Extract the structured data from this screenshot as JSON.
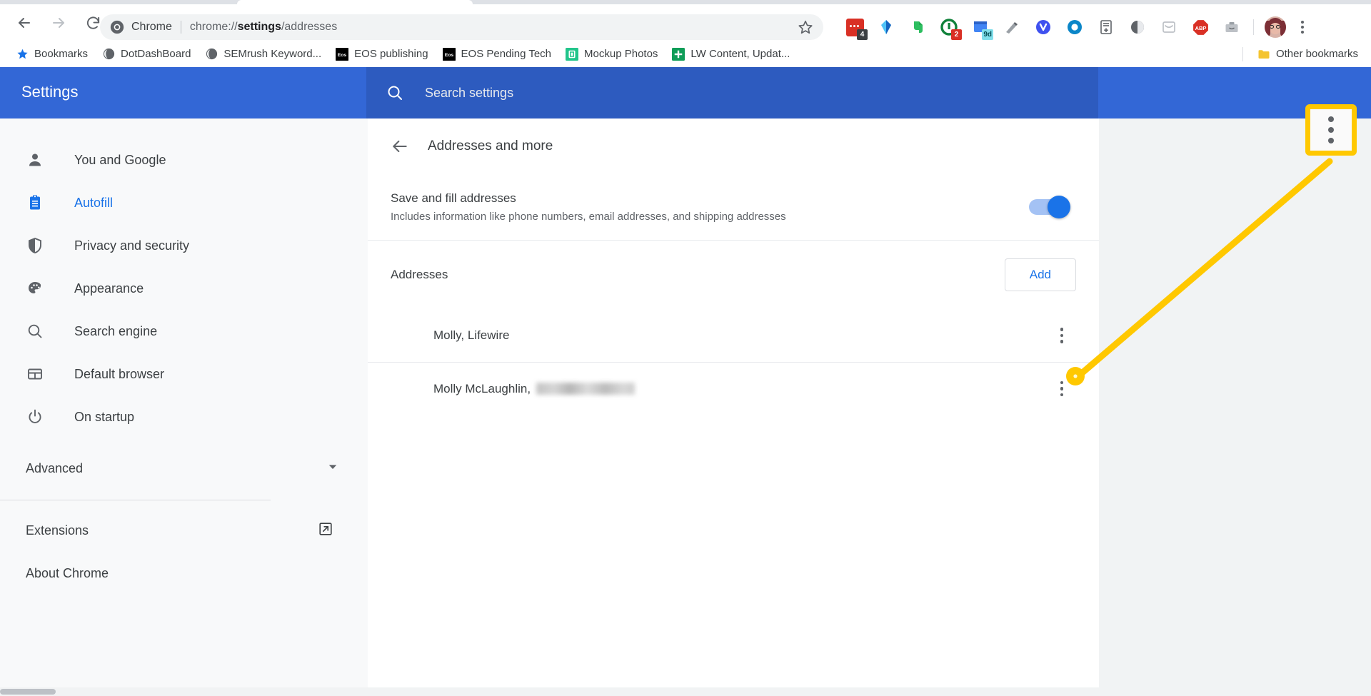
{
  "browser": {
    "nav": {
      "back_icon": "arrow-left-icon",
      "forward_icon": "arrow-right-icon",
      "reload_icon": "reload-icon"
    },
    "omnibox": {
      "chrome_icon": "chrome-logo-icon",
      "label": "Chrome",
      "url_prefix": "chrome://",
      "url_bold": "settings",
      "url_suffix": "/addresses",
      "star_icon": "bookmark-star-icon"
    },
    "extensions": [
      {
        "name": "screen-recorder-extension",
        "badge": "4",
        "badge_color": "#3c4043",
        "color": "#d93025"
      },
      {
        "name": "yandex-extension",
        "badge": "",
        "badge_color": "",
        "color": "#2196f3"
      },
      {
        "name": "evernote-extension",
        "badge": "",
        "badge_color": "",
        "color": "#2dbe60"
      },
      {
        "name": "grammarly-extension",
        "badge": "2",
        "badge_color": "#d93025",
        "color": "#11823b"
      },
      {
        "name": "pocket-extension",
        "badge": "9d",
        "badge_color": "#80deea",
        "color": "#4285f4"
      },
      {
        "name": "marker-extension",
        "badge": "",
        "badge_color": "",
        "color": "#9aa0a6"
      },
      {
        "name": "vivaldi-extension",
        "badge": "",
        "badge_color": "",
        "color": "#3f51ef"
      },
      {
        "name": "office-extension",
        "badge": "",
        "badge_color": "",
        "color": "#0b86c8"
      },
      {
        "name": "add-to-list-extension",
        "badge": "",
        "badge_color": "",
        "color": "#9aa0a6"
      },
      {
        "name": "dark-mode-extension",
        "badge": "",
        "badge_color": "",
        "color": "#5f6368"
      },
      {
        "name": "mail-extension",
        "badge": "",
        "badge_color": "",
        "color": "#bdc1c6"
      },
      {
        "name": "adblock-plus-extension",
        "badge": "",
        "badge_color": "",
        "color": "#d93025",
        "label": "ABP"
      },
      {
        "name": "toolbox-extension",
        "badge": "",
        "badge_color": "",
        "color": "#9aa0a6"
      }
    ],
    "avatar_name": "profile-avatar",
    "menu_icon": "chrome-menu-three-dots-icon"
  },
  "bookmarks_bar": {
    "items": [
      {
        "label": "Bookmarks",
        "icon": "star-icon",
        "icon_color": "#1a73e8"
      },
      {
        "label": "DotDashBoard",
        "icon": "globe-icon",
        "icon_color": "#5f6368"
      },
      {
        "label": "SEMrush Keyword...",
        "icon": "globe-icon",
        "icon_color": "#5f6368"
      },
      {
        "label": "EOS publishing",
        "icon": "eos-icon",
        "icon_color": "#000000"
      },
      {
        "label": "EOS Pending Tech",
        "icon": "eos-icon",
        "icon_color": "#000000"
      },
      {
        "label": "Mockup Photos",
        "icon": "mockup-icon",
        "icon_color": "#22c58b"
      },
      {
        "label": "LW Content, Updat...",
        "icon": "google-sheets-icon",
        "icon_color": "#0f9d58"
      }
    ],
    "other_bookmarks": {
      "label": "Other bookmarks",
      "icon": "folder-icon",
      "icon_color": "#f4c430"
    }
  },
  "settings": {
    "title": "Settings",
    "search": {
      "placeholder": "Search settings",
      "value": "",
      "icon": "search-icon"
    },
    "sidebar": {
      "items": [
        {
          "label": "You and Google",
          "icon": "person-icon",
          "active": false
        },
        {
          "label": "Autofill",
          "icon": "clipboard-icon",
          "active": true
        },
        {
          "label": "Privacy and security",
          "icon": "shield-icon",
          "active": false
        },
        {
          "label": "Appearance",
          "icon": "palette-icon",
          "active": false
        },
        {
          "label": "Search engine",
          "icon": "search-icon",
          "active": false
        },
        {
          "label": "Default browser",
          "icon": "browser-window-icon",
          "active": false
        },
        {
          "label": "On startup",
          "icon": "power-icon",
          "active": false
        }
      ],
      "advanced": {
        "label": "Advanced",
        "icon": "chevron-down-icon"
      },
      "extensions": {
        "label": "Extensions",
        "icon": "external-link-icon"
      },
      "about": {
        "label": "About Chrome"
      }
    },
    "page": {
      "back_icon": "arrow-left-icon",
      "title": "Addresses and more",
      "save_fill": {
        "title": "Save and fill addresses",
        "subtitle": "Includes information like phone numbers, email addresses, and shipping addresses",
        "toggle_on": true,
        "toggle_color": "#1a73e8"
      },
      "addresses_section": {
        "label": "Addresses",
        "add_button": "Add",
        "add_button_color": "#1a73e8",
        "rows": [
          {
            "name": "Molly, Lifewire",
            "redacted": false,
            "menu_icon": "more-vert-icon"
          },
          {
            "name": "Molly McLaughlin,",
            "redacted": true,
            "menu_icon": "more-vert-icon"
          }
        ]
      }
    }
  },
  "annotation": {
    "color": "#ffc800",
    "callout_icon": "more-vert-icon",
    "marker_name": "annotation-dot-marker",
    "line_name": "annotation-pointer-line"
  }
}
